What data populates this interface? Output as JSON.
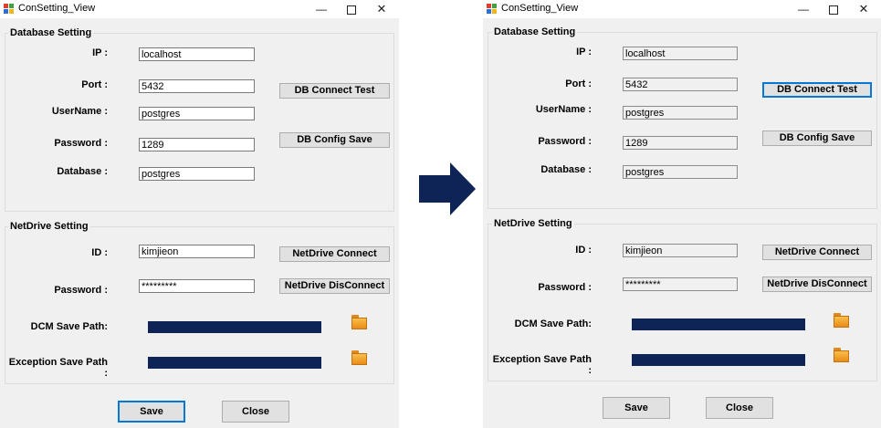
{
  "window_title": "ConSetting_View",
  "title_controls": {
    "minimize": "—",
    "close": "✕"
  },
  "database_setting": {
    "title": "Database Setting",
    "ip_label": "IP :",
    "ip_value": "localhost",
    "port_label": "Port :",
    "port_value": "5432",
    "username_label": "UserName :",
    "username_value": "postgres",
    "password_label": "Password :",
    "password_value": "1289",
    "database_label": "Database :",
    "database_value": "postgres",
    "connect_test_button": "DB Connect Test",
    "config_save_button": "DB Config Save"
  },
  "netdrive_setting": {
    "title": "NetDrive Setting",
    "id_label": "ID :",
    "id_value": "kimjieon",
    "password_label": "Password :",
    "password_value": "*********",
    "connect_button": "NetDrive Connect",
    "disconnect_button": "NetDrive DisConnect",
    "dcm_save_path_label": "DCM Save Path:",
    "dcm_save_path_value": "",
    "exception_save_path_label": "Exception Save Path :",
    "exception_save_path_value": ""
  },
  "footer": {
    "save_button": "Save",
    "close_button": "Close"
  },
  "colors": {
    "path_bar": "#0f2456",
    "arrow": "#0f2456",
    "focus": "#0078d7"
  },
  "icons": {
    "app": "app-window-icon",
    "browse": "folder-icon",
    "transition": "right-arrow-icon"
  }
}
